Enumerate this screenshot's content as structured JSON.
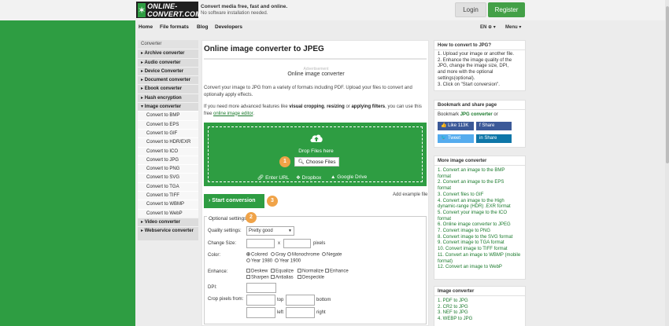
{
  "header": {
    "logo_text": "ONLINE-CONVERT.COM",
    "tagline_1": "Convert media free, fast and online.",
    "tagline_2": "No software installation needed.",
    "login": "Login",
    "register": "Register"
  },
  "nav": {
    "items": [
      "Home",
      "File formats",
      "Blog",
      "Developers"
    ],
    "lang": "EN ⊕ ▾",
    "menu": "Menu ▾"
  },
  "sidebar": {
    "heading": "Converter",
    "top_categories": [
      "Archive converter",
      "Audio converter",
      "Device Converter",
      "Document converter",
      "Ebook converter",
      "Hash encryption",
      "Image converter"
    ],
    "image_subs": [
      "Convert to BMP",
      "Convert to EPS",
      "Convert to GIF",
      "Convert to HDR/EXR",
      "Convert to ICO",
      "Convert to JPG",
      "Convert to PNG",
      "Convert to SVG",
      "Convert to TGA",
      "Convert to TIFF",
      "Convert to WBMP",
      "Convert to WebP"
    ],
    "bottom_categories": [
      "Video converter",
      "Webservice converter"
    ]
  },
  "main": {
    "title": "Online image converter to JPEG",
    "ad_label": "Advertisement",
    "subtitle": "Online image converter",
    "intro": "Convert your image to JPG from a variety of formats including PDF. Upload your files to convert and optionally apply effects.",
    "intro2_a": "If you need more advanced features like ",
    "intro2_b1": "visual cropping",
    "intro2_c": ", ",
    "intro2_b2": "resizing",
    "intro2_d": " or ",
    "intro2_b3": "applying filters",
    "intro2_e": ", you can use this free ",
    "intro2_link": "online image editor",
    "intro2_f": ".",
    "drop_text": "Drop Files here",
    "choose": "Choose Files",
    "enter_url": "Enter URL",
    "dropbox": "Dropbox",
    "gdrive": "Google Drive",
    "badges": [
      "1",
      "2",
      "3"
    ],
    "start": "Start conversion",
    "add_example": "Add example file"
  },
  "options": {
    "legend": "Optional settings",
    "quality_label": "Quality settings:",
    "quality_value": "Pretty good",
    "change_size_label": "Change Size:",
    "size_x": "x",
    "size_unit": "pixels",
    "color_label": "Color:",
    "color_opts": [
      "Colored",
      "Gray",
      "Monochrome",
      "Negate",
      "Year 1980",
      "Year 1900"
    ],
    "enhance_label": "Enhance:",
    "enhance_opts": [
      "Deskew",
      "Equalize",
      "Normalize",
      "Enhance",
      "Sharpen",
      "Antialias",
      "Despeckle"
    ],
    "dpi_label": "DPI:",
    "crop_label": "Crop pixels from:",
    "crop_top": "top",
    "crop_bottom": "bottom",
    "crop_left": "left",
    "crop_right": "right"
  },
  "right": {
    "howto_title": "How to convert to JPG?",
    "howto_lines": [
      "1. Upload your image or another file.",
      "2. Enhance the image quality of the",
      "    JPG, change the image size, DPI,",
      "    and more with the optional",
      "    settings(optional).",
      "3. Click on \"Start conversion\"."
    ],
    "bookmark_title": "Bookmark and share page",
    "bookmark_a": "Bookmark ",
    "bookmark_b": "JPG converter",
    "bookmark_c": " or",
    "like": "👍 Like 113K",
    "share_fb": "f  Share",
    "tweet": "🐦 Tweet",
    "share_in": "in  Share",
    "more_title": "More image converter",
    "more_lines": [
      "1. Convert an image to the BMP",
      "    format",
      "2. Convert an image to the EPS",
      "    format",
      "3. Convert files to GIF",
      "4. Convert an image to the High",
      "    dynamic-range (HDR) .EXR format",
      "5. Convert your image to the ICO",
      "    format",
      "6. Online image converter to JPEG",
      "7. Convert image to PNG",
      "8. Convert image to the SVG format",
      "9. Convert image to TGA format",
      "10. Convert image to TIFF format",
      "11. Convert an image to WBMP (mobile",
      "    format)",
      "12. Convert an image to WebP"
    ],
    "imgconv_title": "Image converter",
    "imgconv_lines": [
      "1. PDF to JPG",
      "2. CR2 to JPG",
      "3. NEF to JPG",
      "4. WEBP to JPG"
    ]
  }
}
